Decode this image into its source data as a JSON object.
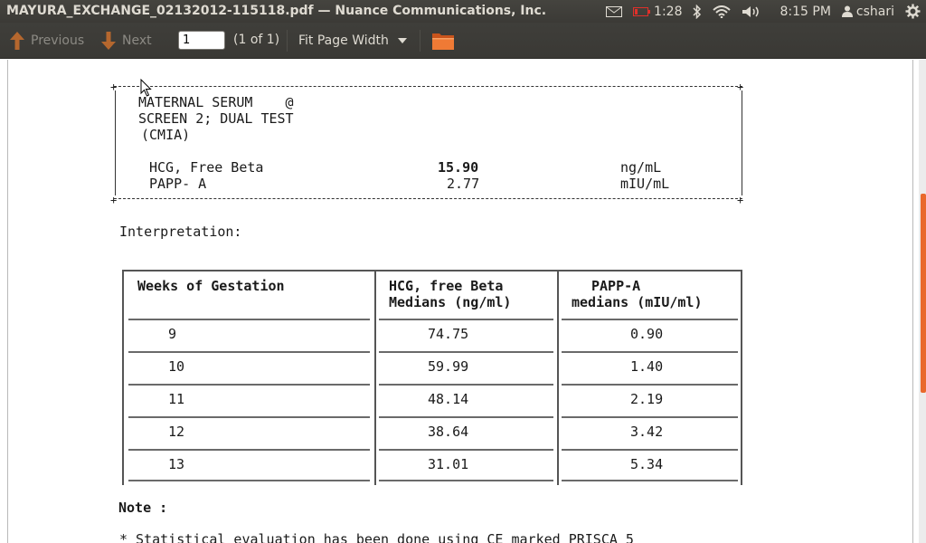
{
  "window": {
    "title": "MAYURA_EXCHANGE_02132012-115118.pdf — Nuance Communications, Inc."
  },
  "tray": {
    "battery_time": "1:28",
    "clock": "8:15 PM",
    "user": "cshari"
  },
  "toolbar": {
    "previous_label": "Previous",
    "next_label": "Next",
    "page_value": "1",
    "page_count": "(1 of 1)",
    "zoom_label": "Fit Page Width"
  },
  "document": {
    "test_title_line1": "MATERNAL SERUM    @",
    "test_title_line2": "SCREEN 2; DUAL TEST",
    "test_title_line3": "(CMIA)",
    "results": [
      {
        "name": "HCG, Free Beta",
        "value": "15.90",
        "unit": "ng/mL"
      },
      {
        "name": "PAPP- A",
        "value": "2.77",
        "unit": "mIU/mL"
      }
    ],
    "interpretation_label": "Interpretation:",
    "table": {
      "headers": [
        {
          "line1": "Weeks of Gestation",
          "line2": ""
        },
        {
          "line1": "HCG, free Beta",
          "line2": "Medians (ng/ml)"
        },
        {
          "line1": "PAPP-A",
          "line2": "medians (mIU/ml)"
        }
      ],
      "rows": [
        {
          "week": "9",
          "hcg": "74.75",
          "papp": "0.90"
        },
        {
          "week": "10",
          "hcg": "59.99",
          "papp": "1.40"
        },
        {
          "week": "11",
          "hcg": "48.14",
          "papp": "2.19"
        },
        {
          "week": "12",
          "hcg": "38.64",
          "papp": "3.42"
        },
        {
          "week": "13",
          "hcg": "31.01",
          "papp": "5.34"
        }
      ]
    },
    "note_label": "Note :",
    "note_text": "* Statistical evaluation has been done using CE marked PRISCA 5"
  },
  "colors": {
    "panel_bg": "#3c3b37",
    "accent_orange": "#e9692c",
    "panel_text": "#dfdbd2"
  }
}
